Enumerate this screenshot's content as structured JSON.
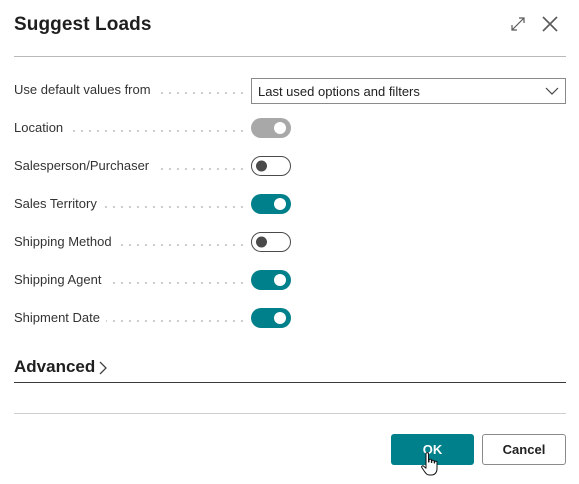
{
  "dialog": {
    "title": "Suggest Loads",
    "expand_icon": "expand-diagonal-icon",
    "close_icon": "close-icon"
  },
  "fields": {
    "default_values": {
      "label": "Use default values from",
      "value": "Last used options and filters"
    },
    "location": {
      "label": "Location",
      "state": "on-disabled"
    },
    "salesperson": {
      "label": "Salesperson/Purchaser",
      "state": "off"
    },
    "sales_territory": {
      "label": "Sales Territory",
      "state": "on"
    },
    "shipping_method": {
      "label": "Shipping Method",
      "state": "off"
    },
    "shipping_agent": {
      "label": "Shipping Agent",
      "state": "on"
    },
    "shipment_date": {
      "label": "Shipment Date",
      "state": "on"
    }
  },
  "advanced": {
    "label": "Advanced"
  },
  "footer": {
    "ok_label": "OK",
    "cancel_label": "Cancel"
  },
  "colors": {
    "accent": "#00808a",
    "toggle_disabled": "#a8a8a8",
    "toggle_off_border": "#4a4a4a"
  }
}
